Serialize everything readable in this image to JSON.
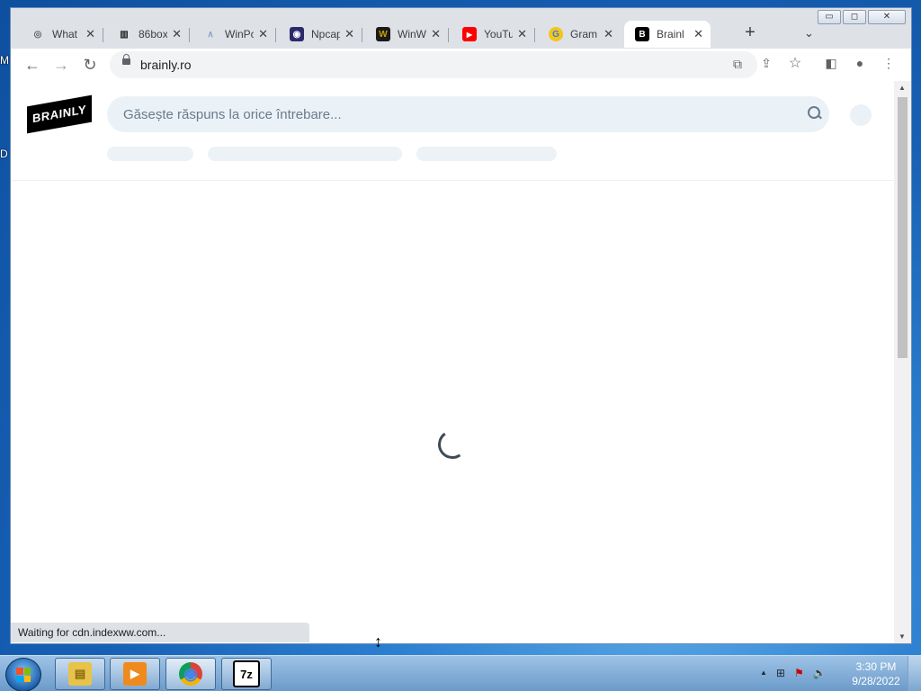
{
  "desktop": {
    "frag_top": "M",
    "frag_mid": "D"
  },
  "window": {
    "controls": {
      "minimize": "▭",
      "maximize": "◻",
      "close": "✕"
    }
  },
  "tabs": [
    {
      "title": "What",
      "favicon": "chrome-icon",
      "color": "#5f6368",
      "glyph": "◎"
    },
    {
      "title": "86box",
      "favicon": "museum-icon",
      "color": "#222222",
      "glyph": "▥"
    },
    {
      "title": "WinPc",
      "favicon": "winpcap-icon",
      "color": "#8aa4c8",
      "glyph": "∧"
    },
    {
      "title": "Npcap",
      "favicon": "eye-icon",
      "color": "#2c2a6a",
      "glyph": "◉"
    },
    {
      "title": "WinW",
      "favicon": "winworld-icon",
      "color": "#c8a000",
      "glyph": "W"
    },
    {
      "title": "YouTu",
      "favicon": "youtube-icon",
      "color": "#ff0000",
      "glyph": "▶"
    },
    {
      "title": "Gram",
      "favicon": "grammar-icon",
      "color": "#2f80ed",
      "glyph": "G"
    },
    {
      "title": "Brainl",
      "favicon": "brainly-icon",
      "color": "#000000",
      "glyph": "B"
    }
  ],
  "tab_close": "✕",
  "new_tab": "+",
  "tab_search": "⌄",
  "toolbar": {
    "back": "←",
    "forward": "→",
    "reload": "↻",
    "url": "brainly.ro",
    "translate": "⧉",
    "share": "⇪",
    "bookmark": "☆",
    "sidepanel": "◧",
    "profile": "●",
    "menu": "⋮"
  },
  "page": {
    "logo": "BRAINLY",
    "search_placeholder": "Găsește răspuns la orice întrebare..."
  },
  "status_text": "Waiting for cdn.indexww.com...",
  "taskbar": {
    "apps": [
      {
        "name": "explorer",
        "glyph": "▤",
        "color": "#e8c34a"
      },
      {
        "name": "media-player",
        "glyph": "▶",
        "color": "#f08a1c"
      },
      {
        "name": "chrome",
        "glyph": "◉",
        "color": "#db4437"
      },
      {
        "name": "7zip",
        "glyph": "7z",
        "color": "#ffffff"
      }
    ],
    "tray": {
      "up": "▲",
      "network": "⊞",
      "flag": "⚑",
      "volume": "🔈"
    },
    "time": "3:30 PM",
    "date": "9/28/2022"
  }
}
